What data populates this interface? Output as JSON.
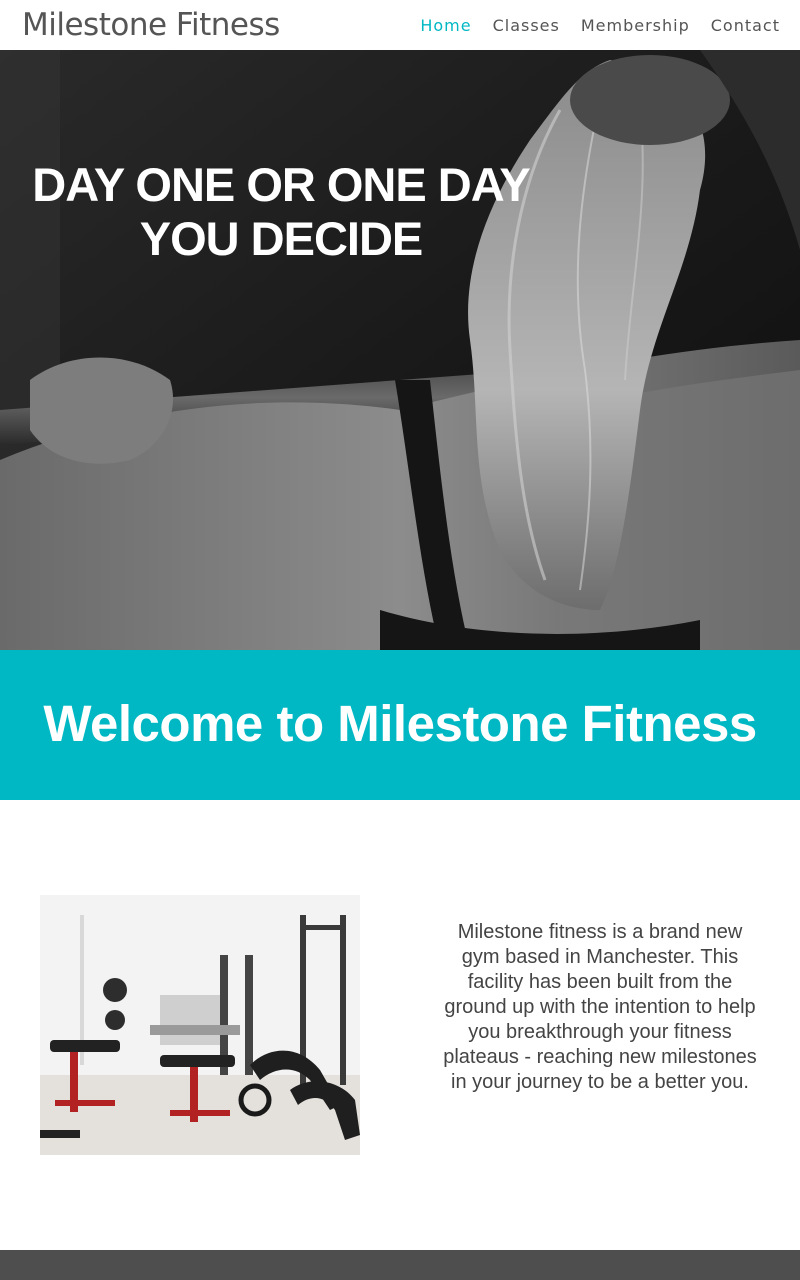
{
  "site": {
    "logo": "Milestone Fitness"
  },
  "nav": {
    "items": [
      {
        "label": "Home",
        "active": true
      },
      {
        "label": "Classes",
        "active": false
      },
      {
        "label": "Membership",
        "active": false
      },
      {
        "label": "Contact",
        "active": false
      }
    ]
  },
  "hero": {
    "line1": "DAY ONE OR ONE DAY",
    "line2": "YOU DECIDE"
  },
  "welcome": {
    "title": "Welcome to Milestone Fitness"
  },
  "about": {
    "text": "Milestone fitness is a brand new gym based in Manchester. This facility has been built from the ground up with the intention to help you breakthrough your fitness plateaus - reaching new milestones in your journey to be a better you."
  },
  "colors": {
    "accent": "#00b8c4",
    "nav_text": "#555555",
    "footer": "#4e4e4e"
  }
}
